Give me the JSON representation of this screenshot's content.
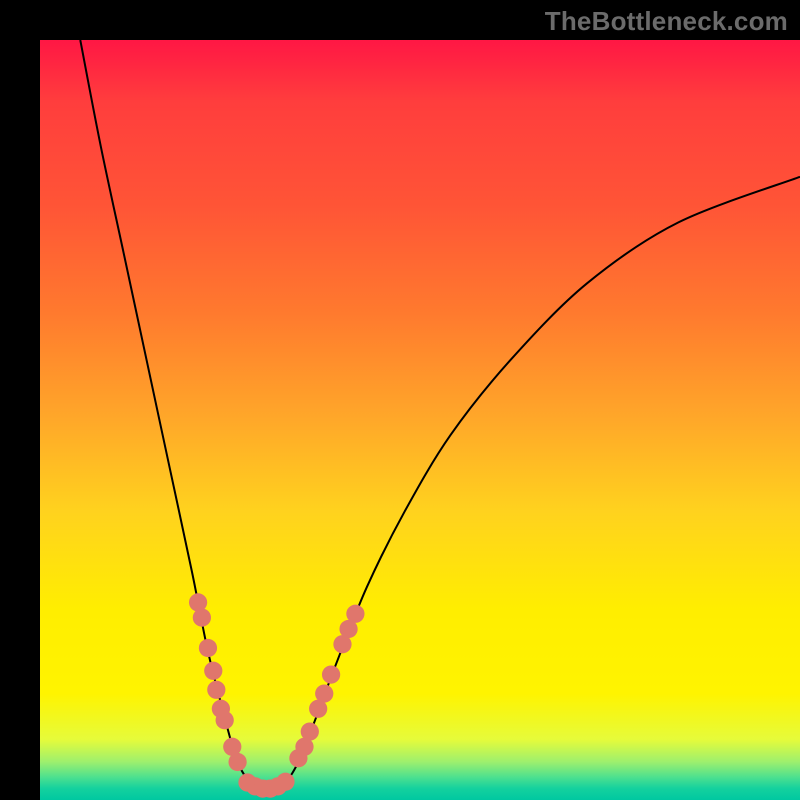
{
  "watermark": "TheBottleneck.com",
  "chart_data": {
    "type": "line",
    "title": "",
    "xlabel": "",
    "ylabel": "",
    "xlim": [
      0,
      100
    ],
    "ylim": [
      0,
      100
    ],
    "curve": [
      {
        "x": 5.3,
        "y": 100
      },
      {
        "x": 8.0,
        "y": 86
      },
      {
        "x": 11.0,
        "y": 72
      },
      {
        "x": 14.0,
        "y": 58
      },
      {
        "x": 17.0,
        "y": 44
      },
      {
        "x": 20.0,
        "y": 30
      },
      {
        "x": 22.0,
        "y": 20
      },
      {
        "x": 24.0,
        "y": 12
      },
      {
        "x": 26.0,
        "y": 5
      },
      {
        "x": 28.0,
        "y": 2
      },
      {
        "x": 30.0,
        "y": 1.5
      },
      {
        "x": 32.0,
        "y": 2
      },
      {
        "x": 34.0,
        "y": 5
      },
      {
        "x": 36.0,
        "y": 10
      },
      {
        "x": 39.0,
        "y": 18
      },
      {
        "x": 43.0,
        "y": 28
      },
      {
        "x": 48.0,
        "y": 38
      },
      {
        "x": 54.0,
        "y": 48
      },
      {
        "x": 62.0,
        "y": 58
      },
      {
        "x": 72.0,
        "y": 68
      },
      {
        "x": 84.0,
        "y": 76
      },
      {
        "x": 100.0,
        "y": 82
      }
    ],
    "markers_left": [
      {
        "x": 20.8,
        "y": 26.0
      },
      {
        "x": 21.3,
        "y": 24.0
      },
      {
        "x": 22.1,
        "y": 20.0
      },
      {
        "x": 22.8,
        "y": 17.0
      },
      {
        "x": 23.2,
        "y": 14.5
      },
      {
        "x": 23.8,
        "y": 12.0
      },
      {
        "x": 24.3,
        "y": 10.5
      },
      {
        "x": 25.3,
        "y": 7.0
      },
      {
        "x": 26.0,
        "y": 5.0
      }
    ],
    "markers_bottom": [
      {
        "x": 27.3,
        "y": 2.3
      },
      {
        "x": 28.3,
        "y": 1.8
      },
      {
        "x": 29.3,
        "y": 1.5
      },
      {
        "x": 30.3,
        "y": 1.5
      },
      {
        "x": 31.3,
        "y": 1.8
      },
      {
        "x": 32.3,
        "y": 2.4
      }
    ],
    "markers_right": [
      {
        "x": 34.0,
        "y": 5.5
      },
      {
        "x": 34.8,
        "y": 7.0
      },
      {
        "x": 35.5,
        "y": 9.0
      },
      {
        "x": 36.6,
        "y": 12.0
      },
      {
        "x": 37.4,
        "y": 14.0
      },
      {
        "x": 38.3,
        "y": 16.5
      },
      {
        "x": 39.8,
        "y": 20.5
      },
      {
        "x": 40.6,
        "y": 22.5
      },
      {
        "x": 41.5,
        "y": 24.5
      }
    ],
    "marker_radius": 1.2,
    "colors": {
      "curve": "#000000",
      "marker": "#e0766c",
      "gradient_top": "#ff1744",
      "gradient_bottom": "#00c8a0"
    }
  }
}
